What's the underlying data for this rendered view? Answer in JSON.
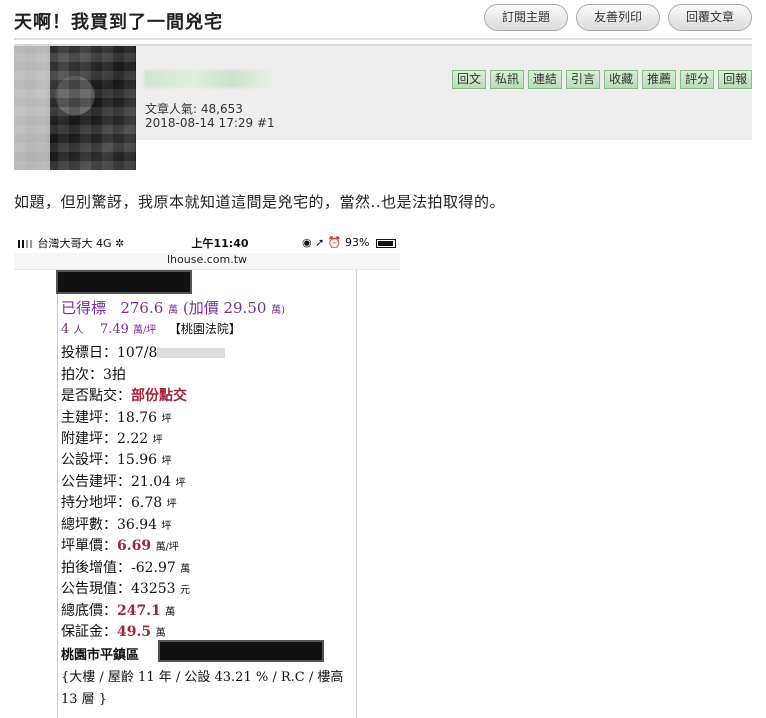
{
  "title": "天啊！我買到了一間兇宅",
  "top_buttons": [
    "訂閱主題",
    "友善列印",
    "回覆文章"
  ],
  "post": {
    "popularity_label": "文章人氣: 48,653",
    "date": "2018-08-14 17:29",
    "floor": "#1",
    "actions": [
      "回文",
      "私訊",
      "連結",
      "引言",
      "收藏",
      "推薦",
      "評分",
      "回報"
    ],
    "body": "如題，但別驚訝，我原本就知道這間是兇宅的，當然..也是法拍取得的。"
  },
  "phone": {
    "carrier": "台灣大哥大  4G",
    "time": "上午11:40",
    "battery": "93%",
    "url": "lhouse.com.tw",
    "listing": {
      "status": "已得標",
      "price": "276.6",
      "price_unit": "萬",
      "premium": "(加價 29.50",
      "premium_unit": "萬)",
      "bidders": "4",
      "bidders_unit": "人",
      "unit_price_small": "7.49",
      "unit_price_small_unit": "萬/坪",
      "court": "【桃園法院】",
      "bid_date_label": "投標日：107/8",
      "auction_round": "拍次：3拍",
      "handover_label": "是否點交：",
      "handover_value": "部份點交",
      "main_area": "主建坪：18.76",
      "sub_area": "附建坪：2.22",
      "public_area": "公設坪：15.96",
      "announced_area": "公告建坪：21.04",
      "land_share": "持分地坪：6.78",
      "total_area": "總坪數：36.94",
      "unit_price_label": "坪單價：",
      "unit_price_value": "6.69",
      "unit_price_unit": "萬/坪",
      "post_value_label": "拍後增值：-62.97",
      "current_value_label": "公告現值：43253",
      "current_value_unit": "元",
      "base_price_label": "總底價：",
      "base_price_value": "247.1",
      "deposit_label": "保証金：",
      "deposit_value": "49.5",
      "wan": "萬",
      "ping": "坪",
      "district": "桃園市平鎮區",
      "details_line1": "{大樓 / 屋齡 11 年 / 公設 43.21 % / R.C / 樓高",
      "details_line2": "13 層 }"
    }
  }
}
